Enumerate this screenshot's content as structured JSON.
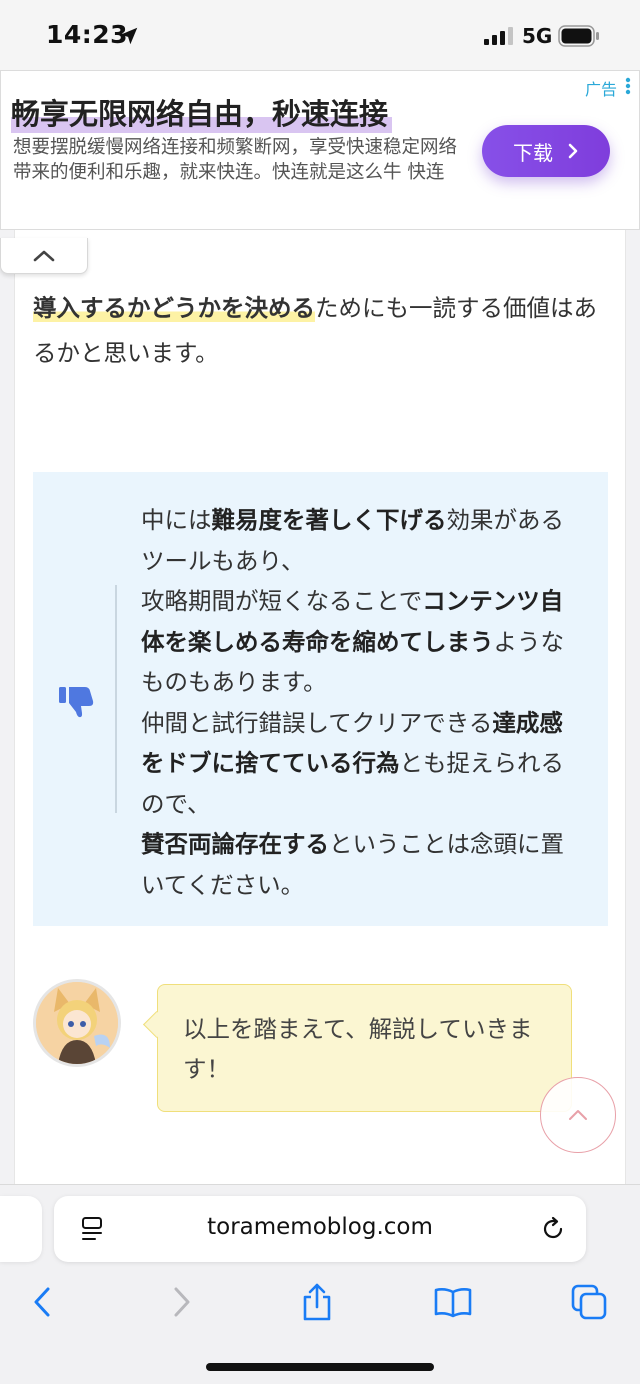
{
  "status_bar": {
    "time": "14:23",
    "network": "5G"
  },
  "ad": {
    "label": "广告",
    "title": "畅享无限网络自由，秒速连接",
    "description": "想要摆脱缓慢网络连接和频繁断网，享受快速稳定网络带来的便利和乐趣，就来快连。快连就是这么牛 快连",
    "button_label": "下载"
  },
  "article": {
    "intro": {
      "highlight": "導入するかどうかを決める",
      "rest": "ためにも一読する価値はあるかと思います。"
    },
    "bad_point": {
      "p1_a": "中には",
      "p1_b": "難易度を著しく下げる",
      "p1_c": "効果があるツールもあり、",
      "p2_a": "攻略期間が短くなることで",
      "p2_b": "コンテンツ自体を楽しめる寿命を縮めてしまう",
      "p2_c": "ようなものもあります。",
      "p3_a": "仲間と試行錯誤してクリアできる",
      "p3_b": "達成感をドブに捨てている行為",
      "p3_c": "とも捉えられるので、",
      "p4_a": "賛否両論存在する",
      "p4_b": "ということは念頭に置いてください。"
    },
    "speech": {
      "text": "以上を踏まえて、解説していきます！"
    }
  },
  "browser": {
    "url": "toramemoblog.com"
  },
  "colors": {
    "ad_button": "#8750e8",
    "ad_label": "#2aa8d8",
    "marker": "#fdf2a5",
    "bad_box_bg": "#eaf5fd",
    "thumbs_icon": "#4f78e0",
    "bubble_bg": "#fbf6d2",
    "ios_blue": "#1a7cf5"
  },
  "icons": [
    "location-arrow-icon",
    "signal-icon",
    "battery-icon",
    "ad-menu-icon",
    "chevron-right-icon",
    "chevron-up-icon",
    "thumbs-down-icon",
    "page-menu-icon",
    "reload-icon",
    "back-arrow-icon",
    "forward-arrow-icon",
    "share-icon",
    "bookmarks-icon",
    "tabs-icon"
  ]
}
